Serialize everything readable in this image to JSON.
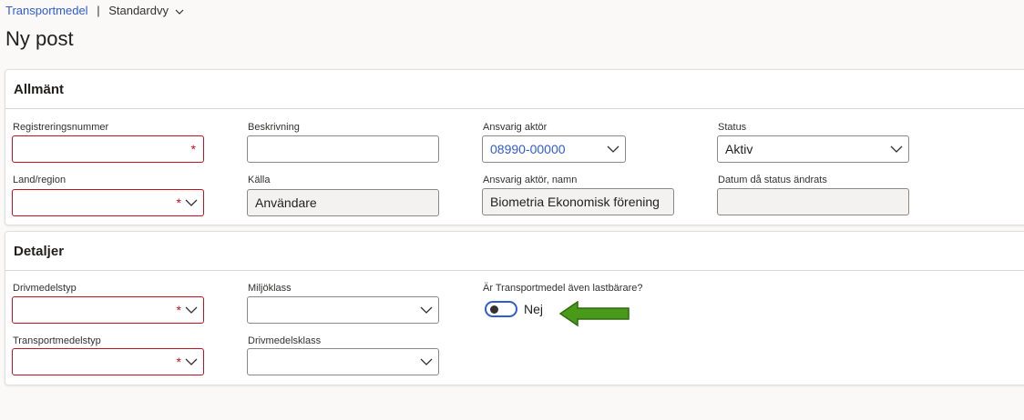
{
  "breadcrumb": {
    "module": "Transportmedel",
    "separator": "|",
    "view": "Standardvy",
    "view_chevron": "chevron-down-icon"
  },
  "page": {
    "title": "Ny post"
  },
  "general": {
    "title": "Allmänt",
    "registreringsnummer": {
      "label": "Registreringsnummer",
      "value": "",
      "required": true
    },
    "beskrivning": {
      "label": "Beskrivning",
      "value": ""
    },
    "ansvarig_aktor": {
      "label": "Ansvarig aktör",
      "value": "08990-00000"
    },
    "status": {
      "label": "Status",
      "value": "Aktiv"
    },
    "land_region": {
      "label": "Land/region",
      "value": "",
      "required": true
    },
    "kalla": {
      "label": "Källa",
      "value": "Användare"
    },
    "ansvarig_aktor_namn": {
      "label": "Ansvarig aktör, namn",
      "value": "Biometria Ekonomisk förening"
    },
    "datum_status": {
      "label": "Datum då status ändrats",
      "value": ""
    }
  },
  "details": {
    "title": "Detaljer",
    "drivmedelstyp": {
      "label": "Drivmedelstyp",
      "value": "",
      "required": true
    },
    "miljoklass": {
      "label": "Miljöklass",
      "value": ""
    },
    "lastbarare": {
      "label": "Är Transportmedel även lastbärare?",
      "value": "Nej",
      "on": false
    },
    "transportmedelstyp": {
      "label": "Transportmedelstyp",
      "value": "",
      "required": true
    },
    "drivmedelsklass": {
      "label": "Drivmedelsklass",
      "value": ""
    }
  },
  "required_marker": "*",
  "colors": {
    "accent": "#2f5bd4",
    "required": "#c50f1f",
    "annotation_arrow": "#4a9a1a"
  }
}
